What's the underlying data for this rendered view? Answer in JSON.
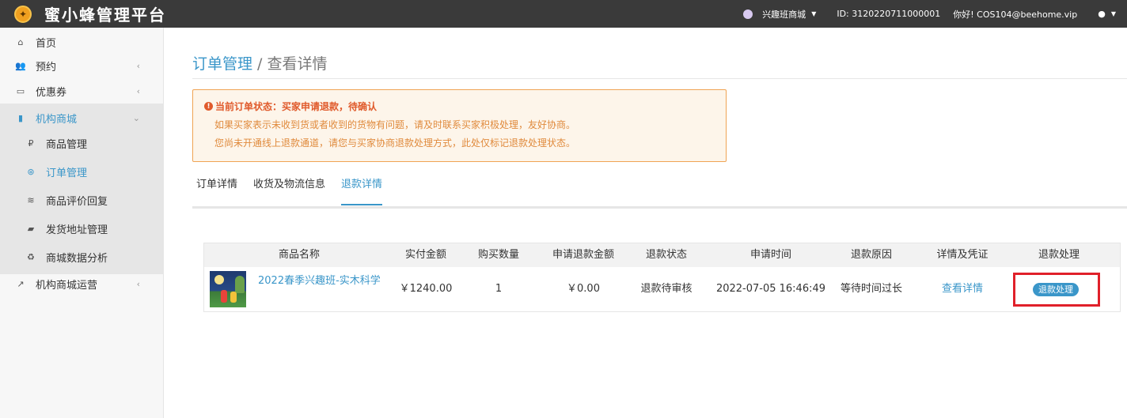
{
  "app": {
    "title": "蜜小蜂管理平台",
    "logo_icon": "bee-logo-icon"
  },
  "header": {
    "shop_name": "兴趣班商城",
    "id_text": "ID:  3120220711000001",
    "greeting": "你好! COS104@beehome.vip",
    "user_icon": "user-icon"
  },
  "sidebar": {
    "items": [
      {
        "label": "首页",
        "icon": "home-icon"
      },
      {
        "label": "预约",
        "icon": "users-icon"
      },
      {
        "label": "优惠券",
        "icon": "coupon-icon"
      },
      {
        "label": "机构商城",
        "icon": "store-icon"
      },
      {
        "label": "商品管理",
        "icon": "ruble-icon"
      },
      {
        "label": "订单管理",
        "icon": "order-icon"
      },
      {
        "label": "商品评价回复",
        "icon": "feed-icon"
      },
      {
        "label": "发货地址管理",
        "icon": "truck-icon"
      },
      {
        "label": "商城数据分析",
        "icon": "recycle-icon"
      },
      {
        "label": "机构商城运营",
        "icon": "chart-icon"
      }
    ]
  },
  "breadcrumb": {
    "parent": "订单管理",
    "separator": " / ",
    "current": "查看详情"
  },
  "alert": {
    "title": "当前订单状态：买家申请退款，待确认",
    "line1": "如果买家表示未收到货或者收到的货物有问题，请及时联系买家积极处理，友好协商。",
    "line2": "您尚未开通线上退款通道，请您与买家协商退款处理方式，此处仅标记退款处理状态。"
  },
  "tabs": [
    "订单详情",
    "收货及物流信息",
    "退款详情"
  ],
  "table": {
    "headers": [
      "商品名称",
      "实付金额",
      "购买数量",
      "申请退款金额",
      "退款状态",
      "申请时间",
      "退款原因",
      "详情及凭证",
      "退款处理"
    ],
    "row": {
      "product_name": "2022春季兴趣班-实木科学",
      "paid": "￥1240.00",
      "qty": "1",
      "refund_amount": "￥0.00",
      "status": "退款待审核",
      "time": "2022-07-05 16:46:49",
      "reason": "等待时间过长",
      "detail_link": "查看详情",
      "action": "退款处理"
    }
  },
  "colors": {
    "accent": "#3a96c9",
    "topbar": "#3a3a3a",
    "alert_title": "#e05a2b",
    "alert_text": "#e08a3c",
    "highlight": "#e0202a"
  }
}
